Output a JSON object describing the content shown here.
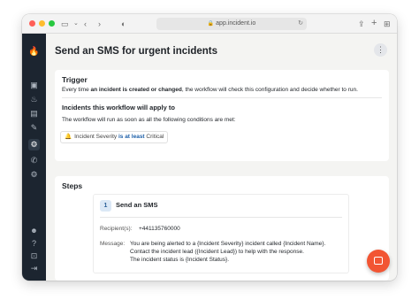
{
  "browser": {
    "url": "app.incident.io"
  },
  "page": {
    "title": "Send an SMS for urgent incidents"
  },
  "trigger": {
    "heading": "Trigger",
    "text_before": "Every time ",
    "text_bold": "an incident is created or changed",
    "text_after": ", the workflow will check this configuration and decide whether to run."
  },
  "conditions": {
    "heading": "Incidents this workflow will apply to",
    "description": "The workflow will run as soon as all the following conditions are met:",
    "items": [
      {
        "field": "Incident Severity",
        "operator": "is at least",
        "value": "Critical"
      }
    ]
  },
  "steps": {
    "heading": "Steps",
    "items": [
      {
        "number": "1",
        "title": "Send an SMS",
        "recipient_label": "Recipient(s):",
        "recipient_value": "+441135760000",
        "message_label": "Message:",
        "message_lines": [
          "You are being alerted to a {Incident Severity} incident called {Incident Name}.",
          "Contact the incident lead ({Incident Lead}) to help with the response.",
          "The incident status is {Incident Status}."
        ]
      }
    ]
  },
  "icons": {
    "sidebar": [
      "logo-icon",
      "dashboard-icon",
      "flame-icon",
      "alert-icon",
      "edit-icon",
      "workflow-icon",
      "phone-icon",
      "settings-icon",
      "avatar-icon",
      "help-icon",
      "gift-icon",
      "logout-icon"
    ]
  },
  "colors": {
    "brand": "#f25533",
    "sidebar": "#1c2530",
    "operator": "#1d5fa8"
  }
}
